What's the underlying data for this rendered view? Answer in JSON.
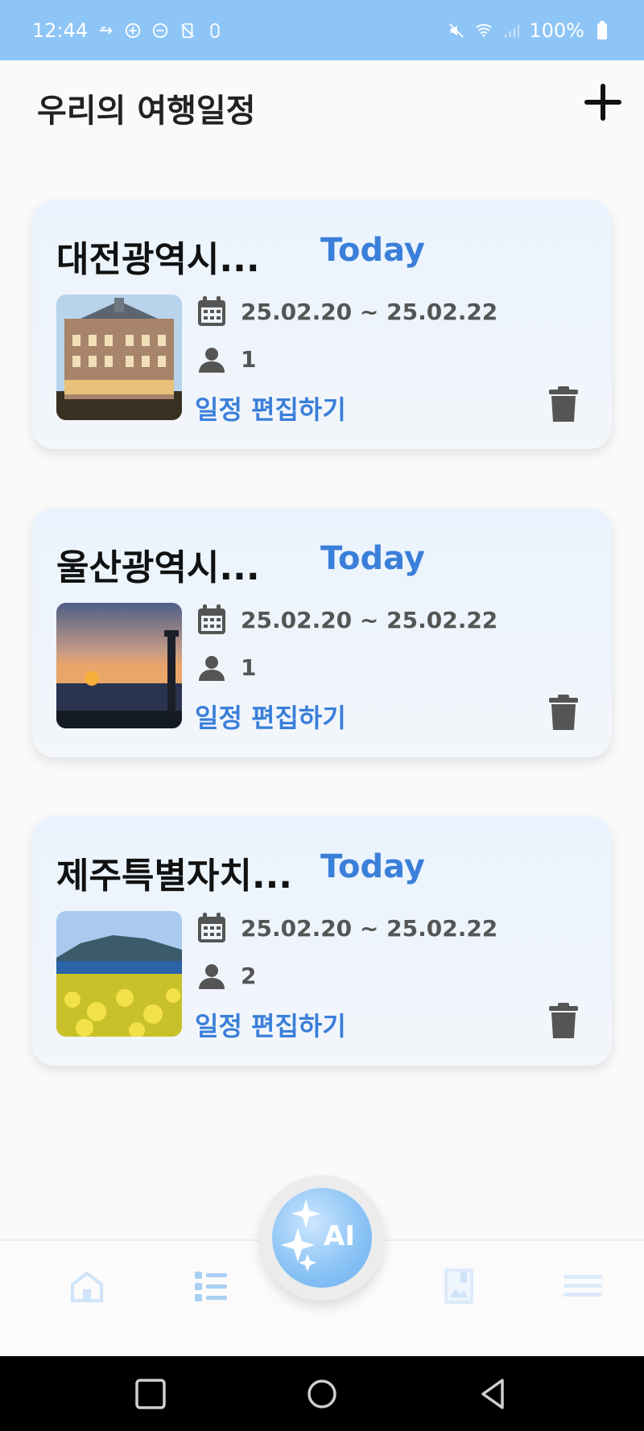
{
  "status_bar": {
    "time": "12:44",
    "battery": "100%",
    "icons_left": [
      "usb-icon",
      "sync-icon",
      "sync-icon",
      "no-sim-icon",
      "notification-icon"
    ],
    "icons_right": [
      "mute-icon",
      "wifi-icon",
      "signal-icon",
      "battery-icon"
    ]
  },
  "header": {
    "title": "우리의 여행일정",
    "add_icon": "plus-icon"
  },
  "trips": [
    {
      "title": "대전광역시...",
      "badge": "Today",
      "dates": "25.02.20 ~ 25.02.22",
      "people": "1",
      "edit_label": "일정 편집하기",
      "image": "building-photo"
    },
    {
      "title": "울산광역시...",
      "badge": "Today",
      "dates": "25.02.20 ~ 25.02.22",
      "people": "1",
      "edit_label": "일정 편집하기",
      "image": "sunset-lighthouse-photo"
    },
    {
      "title": "제주특별자치...",
      "badge": "Today",
      "dates": "25.02.20 ~ 25.02.22",
      "people": "2",
      "edit_label": "일정 편집하기",
      "image": "canola-field-photo"
    }
  ],
  "bottom_nav": {
    "items": [
      "home-icon",
      "list-icon",
      "ai-button",
      "map-icon",
      "menu-icon"
    ],
    "ai_label": "AI"
  },
  "colors": {
    "status_bar": "#8ec5f7",
    "accent": "#3a7fd9",
    "card_bg": "#eaf3fd",
    "icon_gray": "#555555"
  }
}
